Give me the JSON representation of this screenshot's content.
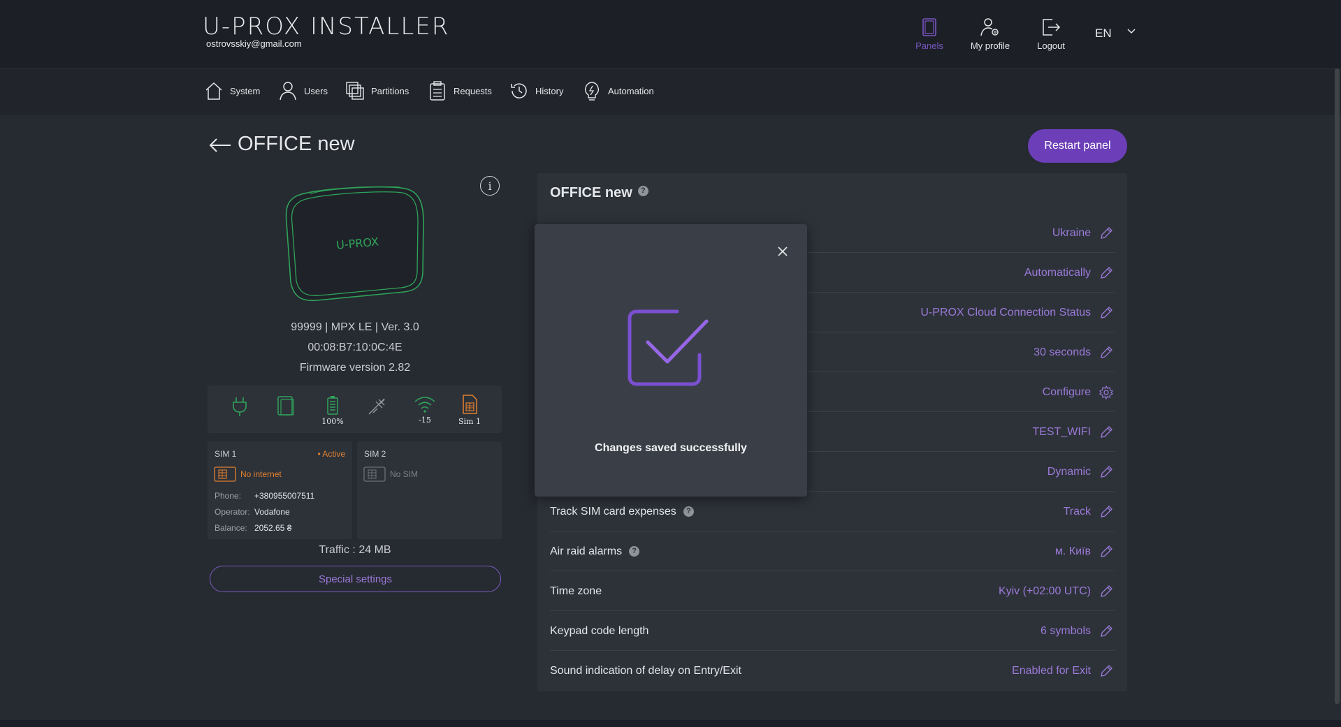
{
  "header": {
    "logo": "U-PROX INSTALLER",
    "email": "ostrovsskiy@gmail.com",
    "actions": [
      {
        "label": "Panels",
        "icon": "panel-device-icon",
        "active": true
      },
      {
        "label": "My profile",
        "icon": "user-settings-icon",
        "active": false
      },
      {
        "label": "Logout",
        "icon": "logout-icon",
        "active": false
      }
    ],
    "language": "EN"
  },
  "nav": {
    "items": [
      {
        "label": "System",
        "icon": "home-icon"
      },
      {
        "label": "Users",
        "icon": "user-icon"
      },
      {
        "label": "Partitions",
        "icon": "partitions-icon"
      },
      {
        "label": "Requests",
        "icon": "clipboard-icon"
      },
      {
        "label": "History",
        "icon": "history-icon"
      },
      {
        "label": "Automation",
        "icon": "lightbulb-icon"
      }
    ]
  },
  "page": {
    "title": "OFFICE new",
    "restart_label": "Restart panel"
  },
  "device": {
    "brand_on_image": "U-PROX",
    "line1": "99999 | MPX LE | Ver. 3.0",
    "line2": "00:08:B7:10:0C:4E",
    "line3": "Firmware version 2.82",
    "status": {
      "battery": "100%",
      "signal": "-15",
      "sim": "Sim 1"
    },
    "sim1": {
      "title": "SIM 1",
      "active": "• Active",
      "internet": "No internet",
      "phone_label": "Phone:",
      "phone": "+380955007511",
      "operator_label": "Operator:",
      "operator": "Vodafone",
      "balance_label": "Balance:",
      "balance": "2052.65 ₴"
    },
    "sim2": {
      "title": "SIM 2",
      "status": "No SIM"
    },
    "traffic": "Traffic : 24 MB",
    "special_label": "Special settings"
  },
  "settings": {
    "title": "OFFICE new",
    "rows": [
      {
        "label": "",
        "value": "Ukraine",
        "action": "edit"
      },
      {
        "label": "",
        "value": "Automatically",
        "action": "edit"
      },
      {
        "label": "",
        "value": "U-PROX Cloud Connection Status",
        "action": "edit"
      },
      {
        "label": "",
        "value": "30 seconds",
        "action": "edit"
      },
      {
        "label": "",
        "value": "Configure",
        "action": "gear"
      },
      {
        "label": "",
        "value": "TEST_WIFI",
        "action": "edit"
      },
      {
        "label": "",
        "value": "Dynamic",
        "action": "edit"
      },
      {
        "label": "Track SIM card expenses",
        "value": "Track",
        "action": "edit",
        "help": true
      },
      {
        "label": "Air raid alarms",
        "value": "м. Київ",
        "action": "edit",
        "help": true
      },
      {
        "label": "Time zone",
        "value": "Kyiv (+02:00 UTC)",
        "action": "edit"
      },
      {
        "label": "Keypad code length",
        "value": "6 symbols",
        "action": "edit"
      },
      {
        "label": "Sound indication of delay on Entry/Exit",
        "value": "Enabled for Exit",
        "action": "edit"
      }
    ]
  },
  "modal": {
    "message": "Changes saved successfully"
  },
  "colors": {
    "accent": "#6c3fb8",
    "accent_text": "#9b7ad8",
    "status_green": "#2fa35a",
    "warning_orange": "#e3802e"
  }
}
